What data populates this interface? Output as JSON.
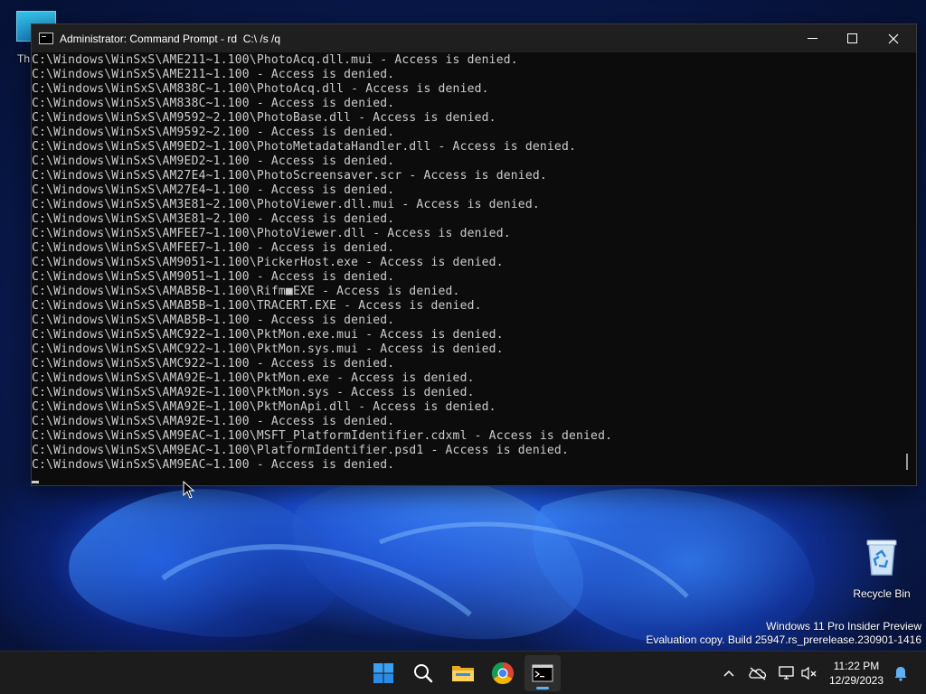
{
  "desktop": {
    "partial_icon_label": "Th",
    "recycle_bin_label": "Recycle Bin",
    "watermark_line1": "Windows 11 Pro Insider Preview",
    "watermark_line2": "Evaluation copy. Build 25947.rs_prerelease.230901-1416"
  },
  "console": {
    "title": "Administrator: Command Prompt - rd  C:\\ /s /q",
    "lines": [
      "C:\\Windows\\WinSxS\\AME211~1.100\\PhotoAcq.dll.mui - Access is denied.",
      "C:\\Windows\\WinSxS\\AME211~1.100 - Access is denied.",
      "C:\\Windows\\WinSxS\\AM838C~1.100\\PhotoAcq.dll - Access is denied.",
      "C:\\Windows\\WinSxS\\AM838C~1.100 - Access is denied.",
      "C:\\Windows\\WinSxS\\AM9592~2.100\\PhotoBase.dll - Access is denied.",
      "C:\\Windows\\WinSxS\\AM9592~2.100 - Access is denied.",
      "C:\\Windows\\WinSxS\\AM9ED2~1.100\\PhotoMetadataHandler.dll - Access is denied.",
      "C:\\Windows\\WinSxS\\AM9ED2~1.100 - Access is denied.",
      "C:\\Windows\\WinSxS\\AM27E4~1.100\\PhotoScreensaver.scr - Access is denied.",
      "C:\\Windows\\WinSxS\\AM27E4~1.100 - Access is denied.",
      "C:\\Windows\\WinSxS\\AM3E81~2.100\\PhotoViewer.dll.mui - Access is denied.",
      "C:\\Windows\\WinSxS\\AM3E81~2.100 - Access is denied.",
      "C:\\Windows\\WinSxS\\AMFEE7~1.100\\PhotoViewer.dll - Access is denied.",
      "C:\\Windows\\WinSxS\\AMFEE7~1.100 - Access is denied.",
      "C:\\Windows\\WinSxS\\AM9051~1.100\\PickerHost.exe - Access is denied.",
      "C:\\Windows\\WinSxS\\AM9051~1.100 - Access is denied.",
      "C:\\Windows\\WinSxS\\AMAB5B~1.100\\Rifm■EXE - Access is denied.",
      "C:\\Windows\\WinSxS\\AMAB5B~1.100\\TRACERT.EXE - Access is denied.",
      "C:\\Windows\\WinSxS\\AMAB5B~1.100 - Access is denied.",
      "C:\\Windows\\WinSxS\\AMC922~1.100\\PktMon.exe.mui - Access is denied.",
      "C:\\Windows\\WinSxS\\AMC922~1.100\\PktMon.sys.mui - Access is denied.",
      "C:\\Windows\\WinSxS\\AMC922~1.100 - Access is denied.",
      "C:\\Windows\\WinSxS\\AMA92E~1.100\\PktMon.exe - Access is denied.",
      "C:\\Windows\\WinSxS\\AMA92E~1.100\\PktMon.sys - Access is denied.",
      "C:\\Windows\\WinSxS\\AMA92E~1.100\\PktMonApi.dll - Access is denied.",
      "C:\\Windows\\WinSxS\\AMA92E~1.100 - Access is denied.",
      "C:\\Windows\\WinSxS\\AM9EAC~1.100\\MSFT_PlatformIdentifier.cdxml - Access is denied.",
      "C:\\Windows\\WinSxS\\AM9EAC~1.100\\PlatformIdentifier.psd1 - Access is denied.",
      "C:\\Windows\\WinSxS\\AM9EAC~1.100 - Access is denied."
    ],
    "colors": {
      "background": "#0c0c0c",
      "text": "#cccccc",
      "titlebar": "#1f1f1f"
    }
  },
  "taskbar": {
    "apps": [
      {
        "name": "start",
        "icon": "windows-logo-icon"
      },
      {
        "name": "search",
        "icon": "search-icon"
      },
      {
        "name": "file-explorer",
        "icon": "folder-icon"
      },
      {
        "name": "chrome",
        "icon": "chrome-icon"
      },
      {
        "name": "command-prompt",
        "icon": "terminal-icon",
        "active": true
      }
    ],
    "tray": {
      "icons": [
        "chevron-up-icon",
        "onedrive-icon",
        "network-icon",
        "volume-muted-icon",
        "notification-bell-icon"
      ],
      "time": "11:22 PM",
      "date": "12/29/2023"
    },
    "accent": "#5fb2f2"
  }
}
